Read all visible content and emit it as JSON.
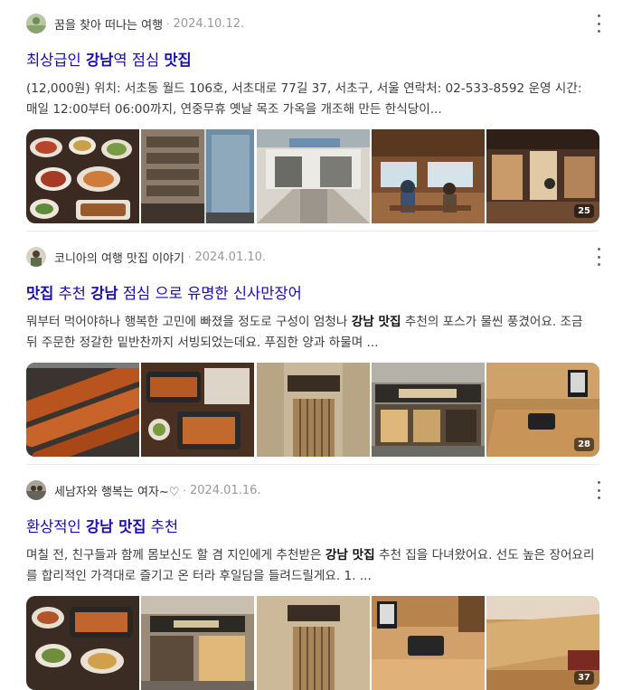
{
  "results": [
    {
      "author": "꿈을 찾아 떠나는 여행",
      "separator": "·",
      "date": "2024.10.12.",
      "title_parts": [
        "최상급인 ",
        "강남",
        "역 점심 ",
        "맛집"
      ],
      "desc_parts": [
        "(12,000원) 위치: 서초동 월드 106호, 서초대로 77길 37, 서초구, 서울 연락처: 02-533-8592 운영 시간: 매일 12:00부터 06:00까지, 연중무휴 옛날 목조 가옥을 개조해 만든 한식당이..."
      ],
      "image_count": "25"
    },
    {
      "author": "코니아의 여행 맛집 이야기",
      "separator": "·",
      "date": "2024.01.10.",
      "title_parts": [
        "맛집",
        " 추천 ",
        "강남",
        " 점심 으로 유명한 신사만장어"
      ],
      "desc_parts": [
        "뭐부터 먹어야하나 행복한 고민에 빠졌을 정도로 구성이 엄청나 ",
        "강남 맛집",
        " 추천의 포스가 물씬 풍겼어요. 조금 뒤 주문한 정갈한 밑반찬까지 서빙되었는데요. 푸짐한 양과 하물며 ..."
      ],
      "image_count": "28"
    },
    {
      "author": "세남자와 행복는 여자~♡",
      "separator": "·",
      "date": "2024.01.16.",
      "title_parts": [
        "환상적인 ",
        "강남 맛집",
        " 추천"
      ],
      "desc_parts": [
        "며칠 전, 친구들과 함께 몸보신도 할 겸 지인에게 추천받은 ",
        "강남 맛집",
        " 추천 집을 다녀왔어요. 선도 높은 장어요리를 합리적인 가격대로 즐기고 온 터라 후일담을 들려드릴게요. 1. ..."
      ],
      "image_count": "37"
    }
  ],
  "icons": {
    "more": "more-vertical-icon",
    "avatar": "avatar"
  },
  "colors": {
    "title": "#1a0dab",
    "meta": "#999999",
    "text": "#3c3c3c"
  }
}
